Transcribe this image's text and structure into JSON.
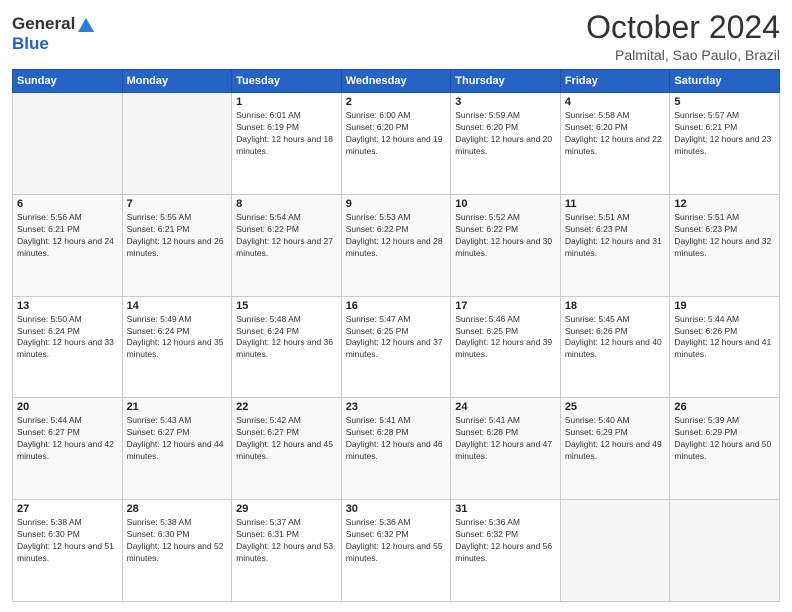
{
  "header": {
    "logo_line1": "General",
    "logo_line2": "Blue",
    "month": "October 2024",
    "location": "Palmital, Sao Paulo, Brazil"
  },
  "days_of_week": [
    "Sunday",
    "Monday",
    "Tuesday",
    "Wednesday",
    "Thursday",
    "Friday",
    "Saturday"
  ],
  "weeks": [
    [
      {
        "num": "",
        "sunrise": "",
        "sunset": "",
        "daylight": "",
        "empty": true
      },
      {
        "num": "",
        "sunrise": "",
        "sunset": "",
        "daylight": "",
        "empty": true
      },
      {
        "num": "1",
        "sunrise": "Sunrise: 6:01 AM",
        "sunset": "Sunset: 6:19 PM",
        "daylight": "Daylight: 12 hours and 18 minutes.",
        "empty": false
      },
      {
        "num": "2",
        "sunrise": "Sunrise: 6:00 AM",
        "sunset": "Sunset: 6:20 PM",
        "daylight": "Daylight: 12 hours and 19 minutes.",
        "empty": false
      },
      {
        "num": "3",
        "sunrise": "Sunrise: 5:59 AM",
        "sunset": "Sunset: 6:20 PM",
        "daylight": "Daylight: 12 hours and 20 minutes.",
        "empty": false
      },
      {
        "num": "4",
        "sunrise": "Sunrise: 5:58 AM",
        "sunset": "Sunset: 6:20 PM",
        "daylight": "Daylight: 12 hours and 22 minutes.",
        "empty": false
      },
      {
        "num": "5",
        "sunrise": "Sunrise: 5:57 AM",
        "sunset": "Sunset: 6:21 PM",
        "daylight": "Daylight: 12 hours and 23 minutes.",
        "empty": false
      }
    ],
    [
      {
        "num": "6",
        "sunrise": "Sunrise: 5:56 AM",
        "sunset": "Sunset: 6:21 PM",
        "daylight": "Daylight: 12 hours and 24 minutes.",
        "empty": false
      },
      {
        "num": "7",
        "sunrise": "Sunrise: 5:55 AM",
        "sunset": "Sunset: 6:21 PM",
        "daylight": "Daylight: 12 hours and 26 minutes.",
        "empty": false
      },
      {
        "num": "8",
        "sunrise": "Sunrise: 5:54 AM",
        "sunset": "Sunset: 6:22 PM",
        "daylight": "Daylight: 12 hours and 27 minutes.",
        "empty": false
      },
      {
        "num": "9",
        "sunrise": "Sunrise: 5:53 AM",
        "sunset": "Sunset: 6:22 PM",
        "daylight": "Daylight: 12 hours and 28 minutes.",
        "empty": false
      },
      {
        "num": "10",
        "sunrise": "Sunrise: 5:52 AM",
        "sunset": "Sunset: 6:22 PM",
        "daylight": "Daylight: 12 hours and 30 minutes.",
        "empty": false
      },
      {
        "num": "11",
        "sunrise": "Sunrise: 5:51 AM",
        "sunset": "Sunset: 6:23 PM",
        "daylight": "Daylight: 12 hours and 31 minutes.",
        "empty": false
      },
      {
        "num": "12",
        "sunrise": "Sunrise: 5:51 AM",
        "sunset": "Sunset: 6:23 PM",
        "daylight": "Daylight: 12 hours and 32 minutes.",
        "empty": false
      }
    ],
    [
      {
        "num": "13",
        "sunrise": "Sunrise: 5:50 AM",
        "sunset": "Sunset: 6:24 PM",
        "daylight": "Daylight: 12 hours and 33 minutes.",
        "empty": false
      },
      {
        "num": "14",
        "sunrise": "Sunrise: 5:49 AM",
        "sunset": "Sunset: 6:24 PM",
        "daylight": "Daylight: 12 hours and 35 minutes.",
        "empty": false
      },
      {
        "num": "15",
        "sunrise": "Sunrise: 5:48 AM",
        "sunset": "Sunset: 6:24 PM",
        "daylight": "Daylight: 12 hours and 36 minutes.",
        "empty": false
      },
      {
        "num": "16",
        "sunrise": "Sunrise: 5:47 AM",
        "sunset": "Sunset: 6:25 PM",
        "daylight": "Daylight: 12 hours and 37 minutes.",
        "empty": false
      },
      {
        "num": "17",
        "sunrise": "Sunrise: 5:46 AM",
        "sunset": "Sunset: 6:25 PM",
        "daylight": "Daylight: 12 hours and 39 minutes.",
        "empty": false
      },
      {
        "num": "18",
        "sunrise": "Sunrise: 5:45 AM",
        "sunset": "Sunset: 6:26 PM",
        "daylight": "Daylight: 12 hours and 40 minutes.",
        "empty": false
      },
      {
        "num": "19",
        "sunrise": "Sunrise: 5:44 AM",
        "sunset": "Sunset: 6:26 PM",
        "daylight": "Daylight: 12 hours and 41 minutes.",
        "empty": false
      }
    ],
    [
      {
        "num": "20",
        "sunrise": "Sunrise: 5:44 AM",
        "sunset": "Sunset: 6:27 PM",
        "daylight": "Daylight: 12 hours and 42 minutes.",
        "empty": false
      },
      {
        "num": "21",
        "sunrise": "Sunrise: 5:43 AM",
        "sunset": "Sunset: 6:27 PM",
        "daylight": "Daylight: 12 hours and 44 minutes.",
        "empty": false
      },
      {
        "num": "22",
        "sunrise": "Sunrise: 5:42 AM",
        "sunset": "Sunset: 6:27 PM",
        "daylight": "Daylight: 12 hours and 45 minutes.",
        "empty": false
      },
      {
        "num": "23",
        "sunrise": "Sunrise: 5:41 AM",
        "sunset": "Sunset: 6:28 PM",
        "daylight": "Daylight: 12 hours and 46 minutes.",
        "empty": false
      },
      {
        "num": "24",
        "sunrise": "Sunrise: 5:41 AM",
        "sunset": "Sunset: 6:28 PM",
        "daylight": "Daylight: 12 hours and 47 minutes.",
        "empty": false
      },
      {
        "num": "25",
        "sunrise": "Sunrise: 5:40 AM",
        "sunset": "Sunset: 6:29 PM",
        "daylight": "Daylight: 12 hours and 49 minutes.",
        "empty": false
      },
      {
        "num": "26",
        "sunrise": "Sunrise: 5:39 AM",
        "sunset": "Sunset: 6:29 PM",
        "daylight": "Daylight: 12 hours and 50 minutes.",
        "empty": false
      }
    ],
    [
      {
        "num": "27",
        "sunrise": "Sunrise: 5:38 AM",
        "sunset": "Sunset: 6:30 PM",
        "daylight": "Daylight: 12 hours and 51 minutes.",
        "empty": false
      },
      {
        "num": "28",
        "sunrise": "Sunrise: 5:38 AM",
        "sunset": "Sunset: 6:30 PM",
        "daylight": "Daylight: 12 hours and 52 minutes.",
        "empty": false
      },
      {
        "num": "29",
        "sunrise": "Sunrise: 5:37 AM",
        "sunset": "Sunset: 6:31 PM",
        "daylight": "Daylight: 12 hours and 53 minutes.",
        "empty": false
      },
      {
        "num": "30",
        "sunrise": "Sunrise: 5:36 AM",
        "sunset": "Sunset: 6:32 PM",
        "daylight": "Daylight: 12 hours and 55 minutes.",
        "empty": false
      },
      {
        "num": "31",
        "sunrise": "Sunrise: 5:36 AM",
        "sunset": "Sunset: 6:32 PM",
        "daylight": "Daylight: 12 hours and 56 minutes.",
        "empty": false
      },
      {
        "num": "",
        "sunrise": "",
        "sunset": "",
        "daylight": "",
        "empty": true
      },
      {
        "num": "",
        "sunrise": "",
        "sunset": "",
        "daylight": "",
        "empty": true
      }
    ]
  ]
}
